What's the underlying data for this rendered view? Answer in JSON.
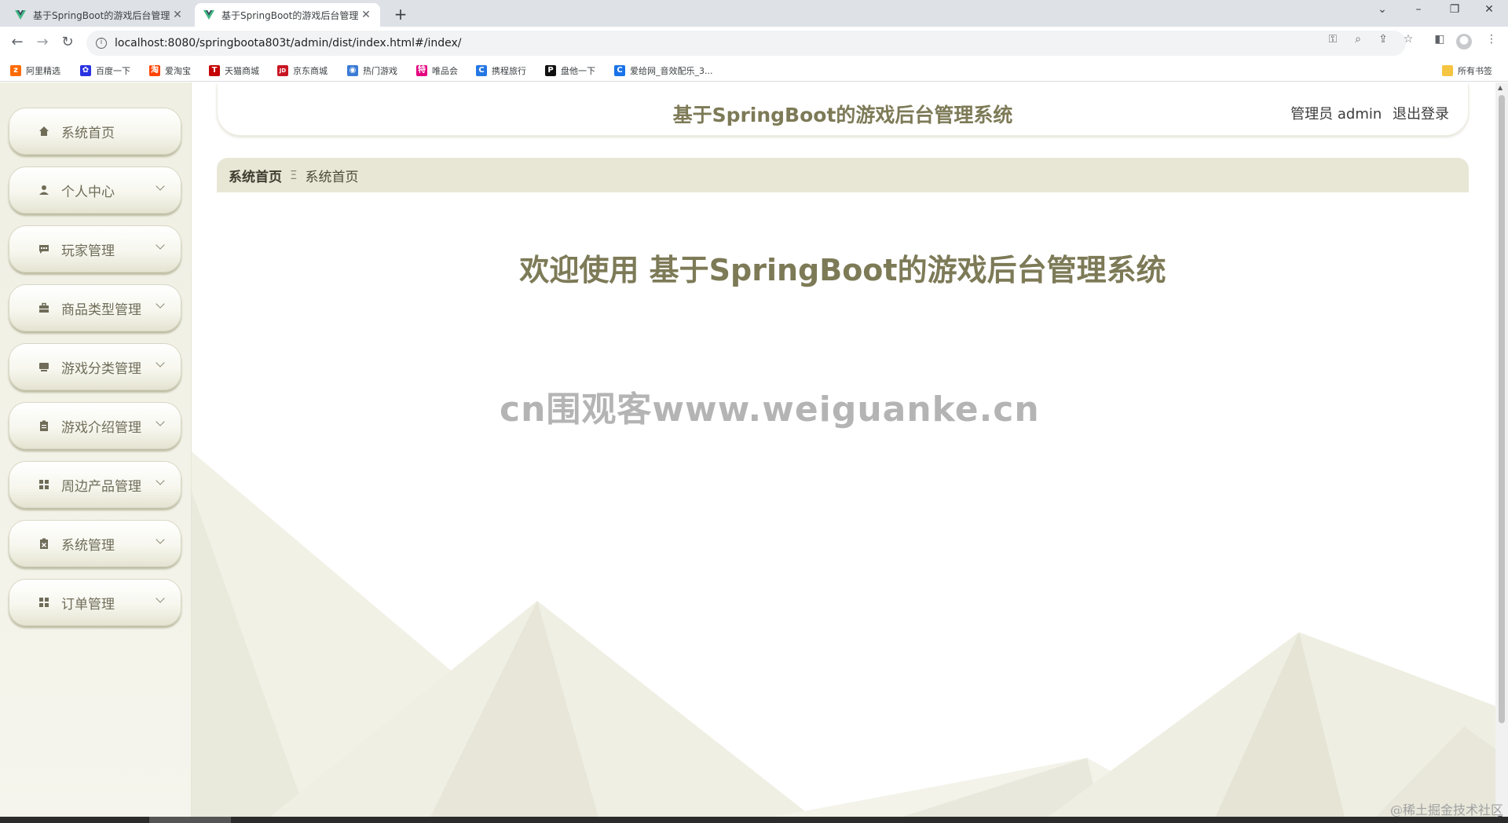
{
  "browser": {
    "tabs": [
      {
        "title": "基于SpringBoot的游戏后台管理",
        "active": false
      },
      {
        "title": "基于SpringBoot的游戏后台管理",
        "active": true
      }
    ],
    "url": "localhost:8080/springboota803t/admin/dist/index.html#/index/",
    "bookmarks": [
      {
        "label": "阿里精选",
        "color": "#ff6a00",
        "glyph": "z"
      },
      {
        "label": "百度一下",
        "color": "#2932e1",
        "glyph": "✿"
      },
      {
        "label": "爱淘宝",
        "color": "#ff4400",
        "glyph": "淘"
      },
      {
        "label": "天猫商城",
        "color": "#c40000",
        "glyph": "T"
      },
      {
        "label": "京东商城",
        "color": "#c91623",
        "glyph": "JD"
      },
      {
        "label": "热门游戏",
        "color": "#3a7bd5",
        "glyph": "◉"
      },
      {
        "label": "唯品会",
        "color": "#e4007f",
        "glyph": "特"
      },
      {
        "label": "携程旅行",
        "color": "#2577e3",
        "glyph": "C"
      },
      {
        "label": "盘他一下",
        "color": "#111111",
        "glyph": "P"
      },
      {
        "label": "爱给网_音效配乐_3...",
        "color": "#1a73e8",
        "glyph": "C"
      }
    ],
    "all_bookmarks": "所有书签"
  },
  "sidebar": {
    "items": [
      {
        "label": "系统首页",
        "icon": "home-icon",
        "expandable": false
      },
      {
        "label": "个人中心",
        "icon": "user-icon",
        "expandable": true
      },
      {
        "label": "玩家管理",
        "icon": "chat-icon",
        "expandable": true
      },
      {
        "label": "商品类型管理",
        "icon": "briefcase-icon",
        "expandable": true
      },
      {
        "label": "游戏分类管理",
        "icon": "monitor-icon",
        "expandable": true
      },
      {
        "label": "游戏介绍管理",
        "icon": "clipboard-icon",
        "expandable": true
      },
      {
        "label": "周边产品管理",
        "icon": "grid-icon",
        "expandable": true
      },
      {
        "label": "系统管理",
        "icon": "clipboard-x-icon",
        "expandable": true
      },
      {
        "label": "订单管理",
        "icon": "grid-icon",
        "expandable": true
      }
    ]
  },
  "header": {
    "title": "基于SpringBoot的游戏后台管理系统",
    "user_label": "管理员 admin",
    "logout_label": "退出登录"
  },
  "breadcrumb": {
    "home": "系统首页",
    "separator": "Ξ",
    "current": "系统首页"
  },
  "main": {
    "welcome": "欢迎使用 基于SpringBoot的游戏后台管理系统"
  },
  "watermark": "cn围观客www.weiguanke.cn",
  "corner_mark": "@稀土掘金技术社区",
  "colors": {
    "accent": "#7d7a57",
    "breadcrumb_bg": "#e8e7d6",
    "sidebar_bg": "#efefe3"
  }
}
